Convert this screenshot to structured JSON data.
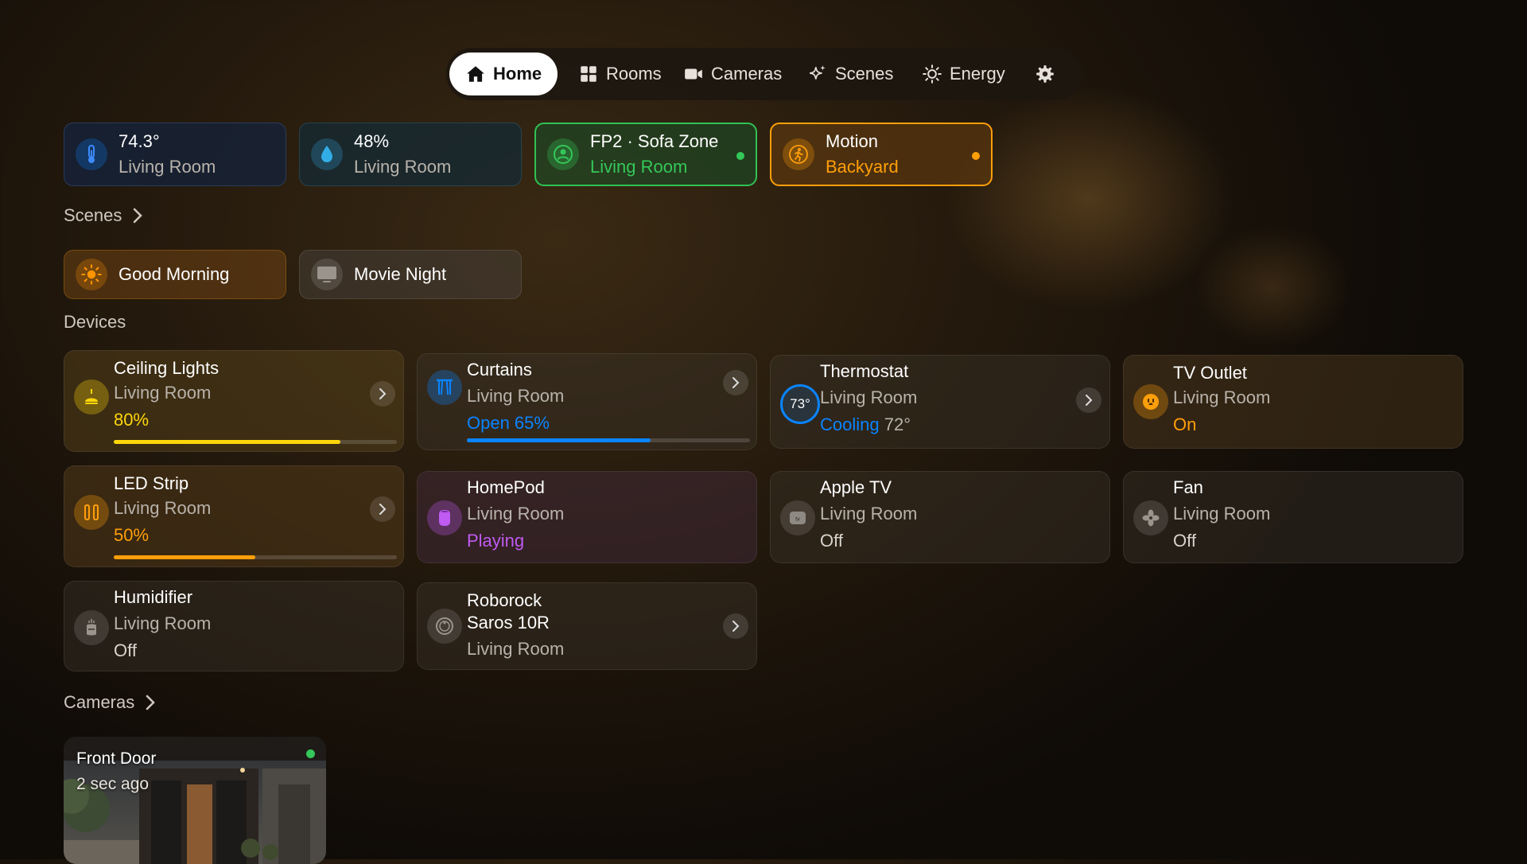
{
  "nav": {
    "items": [
      {
        "label": "Home",
        "icon": "house-icon"
      },
      {
        "label": "Rooms",
        "icon": "grid-icon"
      },
      {
        "label": "Cameras",
        "icon": "video-camera-icon"
      },
      {
        "label": "Scenes",
        "icon": "sparkle-icon"
      },
      {
        "label": "Energy",
        "icon": "sun-icon"
      }
    ],
    "settings_icon": "gear-icon"
  },
  "status_chips": [
    {
      "value": "74.3°",
      "room": "Living Room",
      "icon": "thermometer-icon"
    },
    {
      "value": "48%",
      "room": "Living Room",
      "icon": "water-drop-icon"
    },
    {
      "value": "FP2 · Sofa Zone",
      "room": "Living Room",
      "icon": "person-icon",
      "color": "#34c759"
    },
    {
      "value": "Motion",
      "room": "Backyard",
      "icon": "running-person-icon",
      "color": "#ff9f0a"
    }
  ],
  "scenes": {
    "title": "Scenes",
    "items": [
      {
        "label": "Good Morning",
        "icon": "sun-icon"
      },
      {
        "label": "Movie Night",
        "icon": "tv-icon"
      }
    ]
  },
  "devices": {
    "title": "Devices",
    "items": [
      {
        "name": "Ceiling Lights",
        "room": "Living Room",
        "status": "80%",
        "level": 0.8,
        "color": "#ffd60a",
        "icon": "ceiling-light-icon"
      },
      {
        "name": "Curtains",
        "room": "Living Room",
        "status": "Open 65%",
        "level": 0.65,
        "color": "#0a84ff",
        "icon": "curtains-icon"
      },
      {
        "name": "Thermostat",
        "room": "Living Room",
        "status": "Cooling",
        "status_extra": "72°",
        "badge": "73°",
        "color": "#0a84ff"
      },
      {
        "name": "TV Outlet",
        "room": "Living Room",
        "status": "On",
        "color": "#ff9f0a",
        "icon": "outlet-icon"
      },
      {
        "name": "LED Strip",
        "room": "Living Room",
        "status": "50%",
        "level": 0.5,
        "color": "#ff9f0a",
        "icon": "led-strip-icon"
      },
      {
        "name": "HomePod",
        "room": "Living Room",
        "status": "Playing",
        "color": "#bf5af2",
        "icon": "homepod-icon"
      },
      {
        "name": "Apple TV",
        "room": "Living Room",
        "status": "Off",
        "icon": "apple-tv-icon"
      },
      {
        "name": "Fan",
        "room": "Living Room",
        "status": "Off",
        "icon": "fan-icon"
      },
      {
        "name": "Humidifier",
        "room": "Living Room",
        "status": "Off",
        "icon": "humidifier-icon"
      },
      {
        "name_line1": "Roborock",
        "name_line2": "Saros 10R",
        "room": "Living Room",
        "icon": "robot-vacuum-icon"
      }
    ]
  },
  "cameras": {
    "title": "Cameras",
    "items": [
      {
        "name": "Front Door",
        "time": "2 sec ago",
        "live_color": "#34c759"
      }
    ]
  }
}
